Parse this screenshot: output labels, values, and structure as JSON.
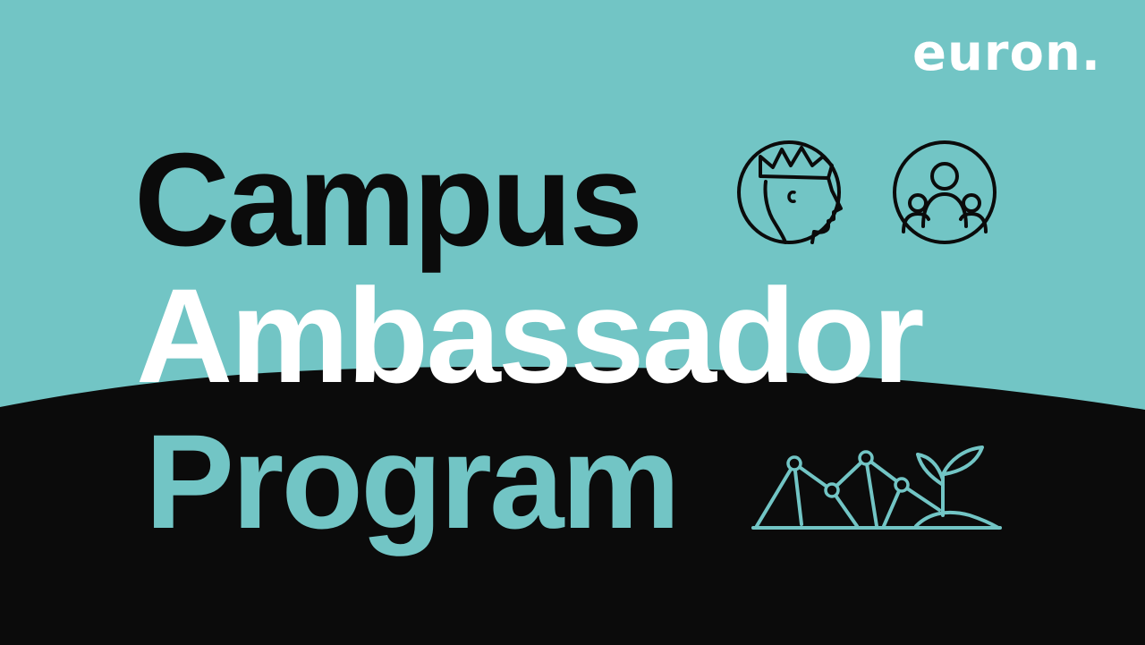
{
  "brand": {
    "logo_text": "euron."
  },
  "title": {
    "line1": "Campus",
    "line2": "Ambassador",
    "line3": "Program"
  },
  "icons": [
    "king-head-icon",
    "community-icon",
    "growth-network-icon"
  ],
  "colors": {
    "teal": "#72c5c5",
    "black": "#0b0b0b",
    "white": "#ffffff"
  }
}
